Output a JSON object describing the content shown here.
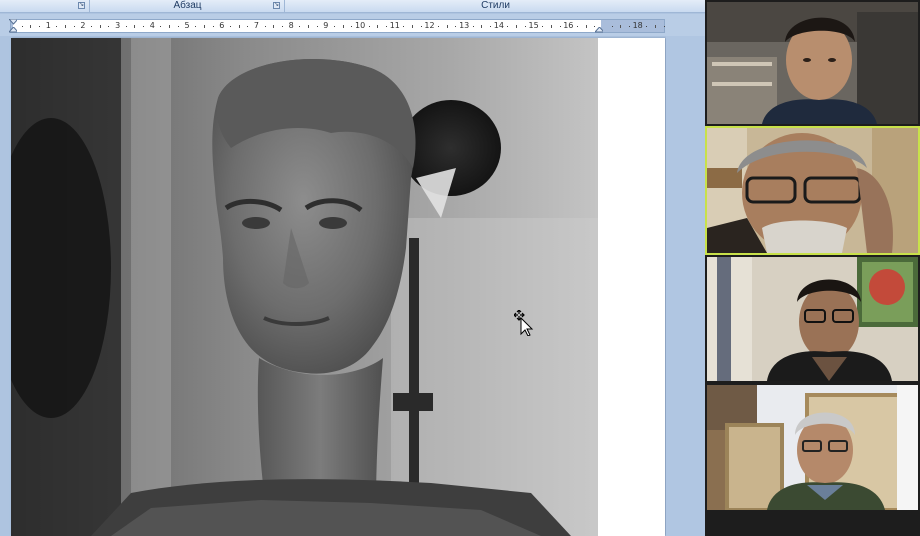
{
  "ribbon": {
    "groups": [
      {
        "label": ""
      },
      {
        "label": "Абзац"
      },
      {
        "label": "Стили"
      }
    ]
  },
  "ruler": {
    "numbers": [
      "1",
      "2",
      "3",
      "4",
      "5",
      "6",
      "7",
      "8",
      "9",
      "10",
      "11",
      "12",
      "13",
      "14",
      "15",
      "16",
      "18"
    ]
  },
  "document": {
    "image_subject": "sculpture-portrait-photo"
  },
  "video_call": {
    "participants": [
      {
        "id": "participant-1",
        "active": false
      },
      {
        "id": "participant-2",
        "active": true
      },
      {
        "id": "participant-3",
        "active": false
      },
      {
        "id": "participant-4",
        "active": false
      }
    ],
    "active_border_color": "#c8e14a"
  },
  "colors": {
    "ribbon_text": "#1f3b63",
    "word_bg": "#aec4e0",
    "page": "#ffffff"
  },
  "icons": [
    "dialog-launcher-icon",
    "move-cursor-icon",
    "indent-marker-icon"
  ]
}
